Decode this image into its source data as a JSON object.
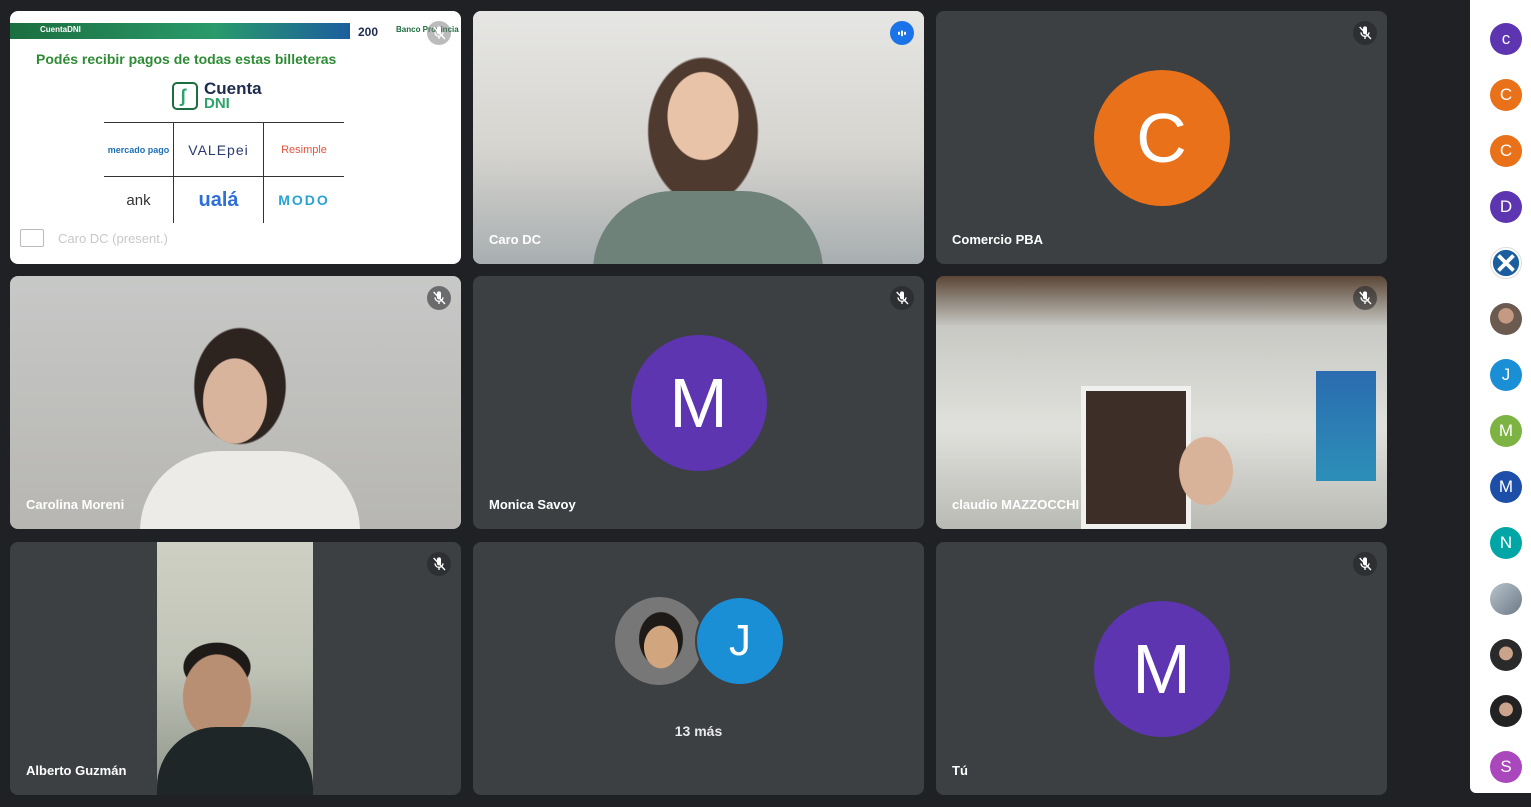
{
  "colors": {
    "speaking_outline": "#8ab4f8",
    "tile_bg": "#3c4043",
    "page_bg": "#202124"
  },
  "slide": {
    "header_logo": "CuentaDNI",
    "header_200": "200",
    "header_bank": "Banco Provincia",
    "title": "Podés recibir pagos de todas estas billeteras",
    "brand_line1": "Cuenta",
    "brand_line2": "DNI",
    "wallets": [
      "mercado pago",
      "VALEpei",
      "Resimple",
      "ank",
      "ualá",
      "MODO"
    ],
    "presenter_label": "Caro DC (present.)"
  },
  "tiles": [
    {
      "name": "Caro DC",
      "speaking": true
    },
    {
      "name": "Comercio PBA",
      "initial": "C",
      "color": "#e8711a"
    },
    {
      "name": "Carolina Moreni"
    },
    {
      "name": "Monica Savoy",
      "initial": "M",
      "color": "#5e35b1"
    },
    {
      "name": "claudio MAZZOCCHI"
    },
    {
      "name": "Alberto Guzmán"
    },
    {
      "group_label": "13 más",
      "initial": "J",
      "color": "#1a8fd6"
    },
    {
      "name": "Tú",
      "initial": "M",
      "color": "#5e35b1"
    }
  ],
  "sidebar": [
    {
      "initial": "c",
      "color": "#5e35b1"
    },
    {
      "initial": "C",
      "color": "#e8711a"
    },
    {
      "initial": "C",
      "color": "#e8711a"
    },
    {
      "initial": "D",
      "color": "#5e35b1"
    },
    {
      "icon": "dx-logo-icon",
      "color": "#1b5e9e"
    },
    {
      "icon": "photo-avatar-icon",
      "color": "#7a6a5e"
    },
    {
      "initial": "J",
      "color": "#1a8fd6"
    },
    {
      "initial": "M",
      "color": "#7cb342"
    },
    {
      "initial": "M",
      "color": "#1e4fa8"
    },
    {
      "initial": "N",
      "color": "#00a5a5"
    },
    {
      "icon": "photo-avatar-icon",
      "color": "#8c97a4"
    },
    {
      "icon": "photo-avatar-icon",
      "color": "#3a3a3a"
    },
    {
      "icon": "photo-avatar-icon",
      "color": "#2c2c2c"
    },
    {
      "initial": "S",
      "color": "#ab47bc"
    }
  ]
}
